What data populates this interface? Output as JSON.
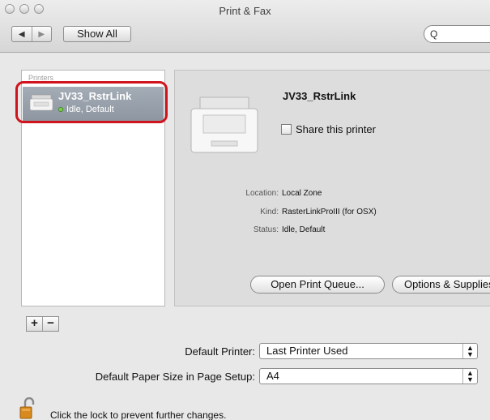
{
  "window": {
    "title": "Print & Fax"
  },
  "toolbar": {
    "back_icon": "left-arrow-icon",
    "forward_icon": "right-arrow-icon",
    "show_all_label": "Show All",
    "search_icon": "search-icon",
    "search_glyph": "Q",
    "search_value": ""
  },
  "printers": {
    "header": "Printers",
    "items": [
      {
        "name": "JV33_RstrLink",
        "status": "Idle, Default",
        "status_color": "#7ed34a"
      }
    ]
  },
  "list_controls": {
    "add_label": "+",
    "remove_label": "−"
  },
  "detail": {
    "name": "JV33_RstrLink",
    "share_label": "Share this printer",
    "share_checked": false,
    "location_label": "Location:",
    "location_value": "Local Zone",
    "kind_label": "Kind:",
    "kind_value": "RasterLinkProIII (for OSX)",
    "status_label": "Status:",
    "status_value": "Idle, Default",
    "open_queue_label": "Open Print Queue...",
    "options_label": "Options & Supplies..."
  },
  "defaults": {
    "default_printer_label": "Default Printer:",
    "default_printer_value": "Last Printer Used",
    "paper_size_label": "Default Paper Size in Page Setup:",
    "paper_size_value": "A4"
  },
  "lock": {
    "icon": "lock-icon",
    "text": "Click the lock to prevent further changes."
  },
  "colors": {
    "highlight": "#d0131c",
    "selection": "#8c95a0",
    "status_dot": "#7ed34a"
  }
}
